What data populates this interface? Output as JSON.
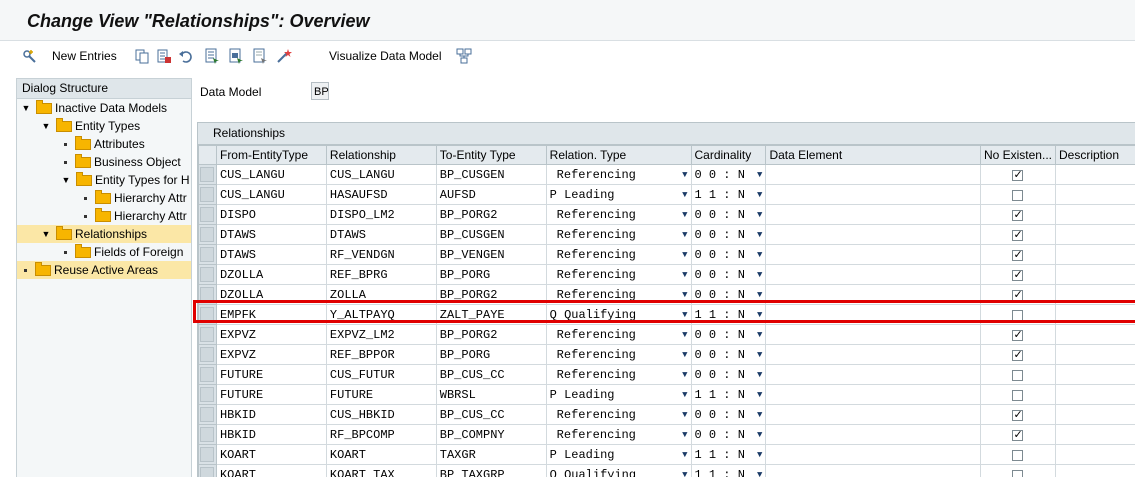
{
  "window": {
    "title": "Change View \"Relationships\": Overview"
  },
  "toolbar": {
    "new_entries": "New Entries",
    "visualize": "Visualize Data Model",
    "icons": [
      "new-entries-icon",
      "copy-icon",
      "delete-icon",
      "undo-icon",
      "select-all-icon",
      "select-block-icon",
      "deselect-all-icon",
      "wand-icon",
      "data-model-icon"
    ]
  },
  "dialog": {
    "header": "Dialog Structure",
    "items": [
      {
        "label": "Inactive Data Models",
        "level": 0,
        "twisty": "open",
        "selected": false
      },
      {
        "label": "Entity Types",
        "level": 1,
        "twisty": "open",
        "selected": false
      },
      {
        "label": "Attributes",
        "level": 2,
        "twisty": "dot",
        "selected": false
      },
      {
        "label": "Business Object",
        "level": 2,
        "twisty": "dot",
        "selected": false
      },
      {
        "label": "Entity Types for H",
        "level": 2,
        "twisty": "open",
        "selected": false
      },
      {
        "label": "Hierarchy Attr",
        "level": 3,
        "twisty": "dot",
        "selected": false
      },
      {
        "label": "Hierarchy Attr",
        "level": 3,
        "twisty": "dot",
        "selected": false
      },
      {
        "label": "Relationships",
        "level": 1,
        "twisty": "open",
        "selected": true
      },
      {
        "label": "Fields of Foreign",
        "level": 2,
        "twisty": "dot",
        "selected": false
      },
      {
        "label": "Reuse Active Areas",
        "level": 0,
        "twisty": "dot",
        "selected": true
      }
    ]
  },
  "data_model": {
    "label": "Data Model",
    "value": "BP"
  },
  "table": {
    "title": "Relationships",
    "columns": [
      "From-EntityType",
      "Relationship",
      "To-Entity Type",
      "Relation. Type",
      "Cardinality",
      "Data Element",
      "No Existen...",
      "Description"
    ],
    "rows": [
      {
        "from": "CUS_LANGU",
        "rel": "CUS_LANGU",
        "to": "BP_CUSGEN",
        "rtype": "Referencing",
        "card": "0 0 : N",
        "de": "",
        "noex": true
      },
      {
        "from": "CUS_LANGU",
        "rel": "HASAUFSD",
        "to": "AUFSD",
        "rtype": "P Leading",
        "card": "1 1 : N",
        "de": "",
        "noex": false
      },
      {
        "from": "DISPO",
        "rel": "DISPO_LM2",
        "to": "BP_PORG2",
        "rtype": "Referencing",
        "card": "0 0 : N",
        "de": "",
        "noex": true
      },
      {
        "from": "DTAWS",
        "rel": "DTAWS",
        "to": "BP_CUSGEN",
        "rtype": "Referencing",
        "card": "0 0 : N",
        "de": "",
        "noex": true
      },
      {
        "from": "DTAWS",
        "rel": "RF_VENDGN",
        "to": "BP_VENGEN",
        "rtype": "Referencing",
        "card": "0 0 : N",
        "de": "",
        "noex": true
      },
      {
        "from": "DZOLLA",
        "rel": "REF_BPRG",
        "to": "BP_PORG",
        "rtype": "Referencing",
        "card": "0 0 : N",
        "de": "",
        "noex": true
      },
      {
        "from": "DZOLLA",
        "rel": "ZOLLA",
        "to": "BP_PORG2",
        "rtype": "Referencing",
        "card": "0 0 : N",
        "de": "",
        "noex": true
      },
      {
        "from": "EMPFK",
        "rel": "Y_ALTPAYQ",
        "to": "ZALT_PAYE",
        "rtype": "Q Qualifying",
        "card": "1 1 : N",
        "de": "",
        "noex": false
      },
      {
        "from": "EXPVZ",
        "rel": "EXPVZ_LM2",
        "to": "BP_PORG2",
        "rtype": "Referencing",
        "card": "0 0 : N",
        "de": "",
        "noex": true
      },
      {
        "from": "EXPVZ",
        "rel": "REF_BPPOR",
        "to": "BP_PORG",
        "rtype": "Referencing",
        "card": "0 0 : N",
        "de": "",
        "noex": true
      },
      {
        "from": "FUTURE",
        "rel": "CUS_FUTUR",
        "to": "BP_CUS_CC",
        "rtype": "Referencing",
        "card": "0 0 : N",
        "de": "",
        "noex": false
      },
      {
        "from": "FUTURE",
        "rel": "FUTURE",
        "to": "WBRSL",
        "rtype": "P Leading",
        "card": "1 1 : N",
        "de": "",
        "noex": false
      },
      {
        "from": "HBKID",
        "rel": "CUS_HBKID",
        "to": "BP_CUS_CC",
        "rtype": "Referencing",
        "card": "0 0 : N",
        "de": "",
        "noex": true
      },
      {
        "from": "HBKID",
        "rel": "RF_BPCOMP",
        "to": "BP_COMPNY",
        "rtype": "Referencing",
        "card": "0 0 : N",
        "de": "",
        "noex": true
      },
      {
        "from": "KOART",
        "rel": "KOART",
        "to": "TAXGR",
        "rtype": "P Leading",
        "card": "1 1 : N",
        "de": "",
        "noex": false
      },
      {
        "from": "KOART",
        "rel": "KOART_TAX",
        "to": "BP_TAXGRP",
        "rtype": "Q Qualifying",
        "card": "1 1 : N",
        "de": "",
        "noex": false
      }
    ]
  }
}
